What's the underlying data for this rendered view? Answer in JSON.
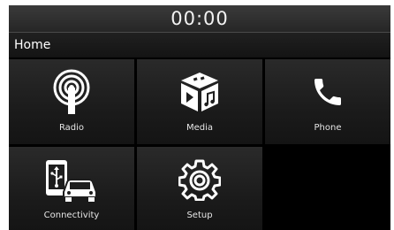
{
  "status_bar": {
    "clock": "00:00"
  },
  "header": {
    "title": "Home"
  },
  "menu": {
    "items": [
      {
        "label": "Radio",
        "icon": "radio-icon"
      },
      {
        "label": "Media",
        "icon": "media-icon"
      },
      {
        "label": "Phone",
        "icon": "phone-icon"
      },
      {
        "label": "Connectivity",
        "icon": "connectivity-icon"
      },
      {
        "label": "Setup",
        "icon": "gear-icon"
      }
    ]
  },
  "colors": {
    "background": "#000000",
    "tile": "#1e1e1e",
    "text": "#ffffff"
  }
}
